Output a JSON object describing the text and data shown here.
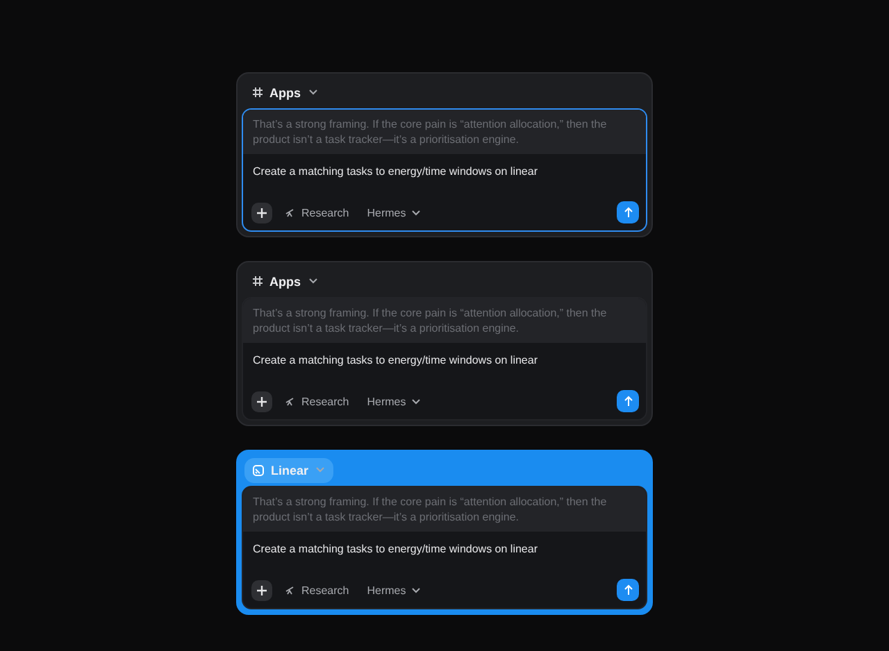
{
  "composers": [
    {
      "app": {
        "label": "Apps",
        "kind": "grid"
      },
      "header_active": false,
      "focused": true,
      "quote": "That’s a strong framing. If the core pain is “attention allocation,” then the product isn’t a task tracker—it’s a prioritisation engine.",
      "message": "Create a matching tasks to energy/time windows on linear",
      "tools": {
        "research": "Research",
        "model": "Hermes"
      }
    },
    {
      "app": {
        "label": "Apps",
        "kind": "grid"
      },
      "header_active": false,
      "focused": false,
      "quote": "That’s a strong framing. If the core pain is “attention allocation,” then the product isn’t a task tracker—it’s a prioritisation engine.",
      "message": "Create a matching tasks to energy/time windows on linear",
      "tools": {
        "research": "Research",
        "model": "Hermes"
      }
    },
    {
      "app": {
        "label": "Linear",
        "kind": "linear"
      },
      "header_active": true,
      "focused": false,
      "quote": "That’s a strong framing. If the core pain is “attention allocation,” then the product isn’t a task tracker—it’s a prioritisation engine.",
      "message": "Create a matching tasks to energy/time windows on linear",
      "tools": {
        "research": "Research",
        "model": "Hermes"
      }
    }
  ]
}
